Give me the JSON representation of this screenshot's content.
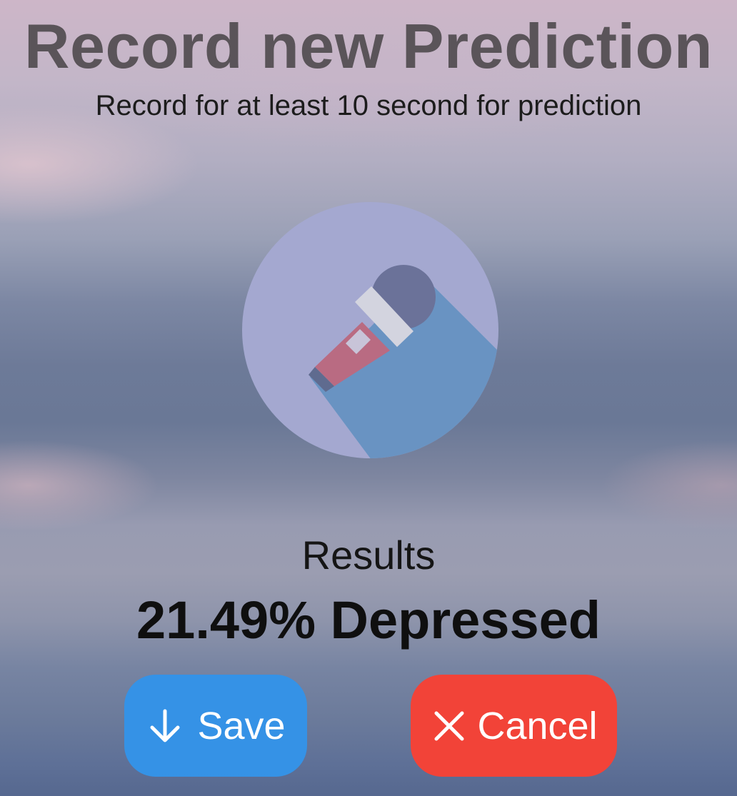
{
  "header": {
    "title": "Record new Prediction",
    "subtitle": "Record for at least 10 second for prediction"
  },
  "recorder": {
    "icon": "microphone-icon"
  },
  "results": {
    "label": "Results",
    "value": "21.49% Depressed"
  },
  "actions": {
    "save_label": "Save",
    "save_icon": "arrow-down-icon",
    "cancel_label": "Cancel",
    "cancel_icon": "close-icon"
  },
  "colors": {
    "save_button": "#3592e6",
    "cancel_button": "#f24338",
    "title_text": "#5a5459"
  }
}
